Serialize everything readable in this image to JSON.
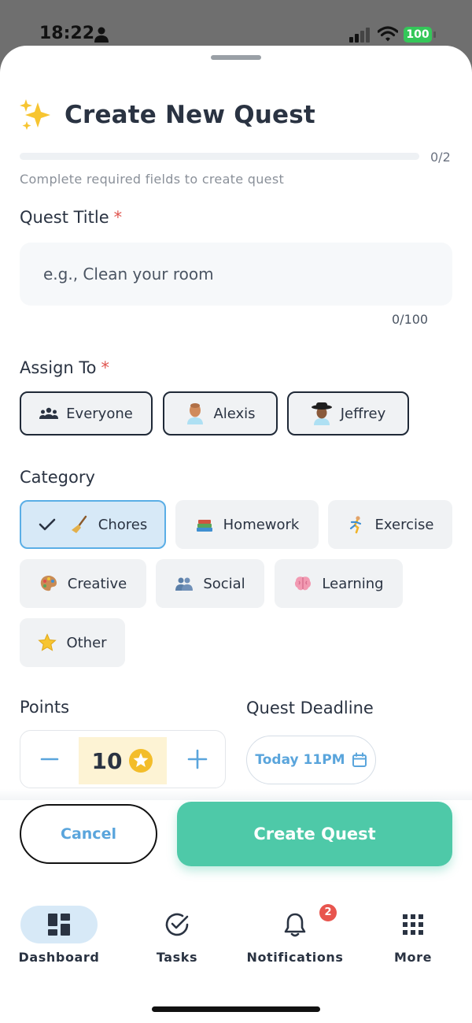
{
  "status": {
    "time": "18:22",
    "battery": "100"
  },
  "header": {
    "title": "Create New Quest"
  },
  "progress": {
    "count": "0/2",
    "fraction": 0,
    "hint": "Complete required fields to create quest"
  },
  "quest_title": {
    "label": "Quest Title",
    "required_mark": "*",
    "placeholder": "e.g., Clean your room",
    "value": "",
    "char_count": "0/100"
  },
  "assign": {
    "label": "Assign To",
    "required_mark": "*",
    "options": [
      {
        "label": "Everyone",
        "icon": "group-icon"
      },
      {
        "label": "Alexis",
        "icon": "avatar-alexis"
      },
      {
        "label": "Jeffrey",
        "icon": "avatar-jeffrey"
      }
    ]
  },
  "category": {
    "label": "Category",
    "selected": "Chores",
    "options": [
      {
        "label": "Chores",
        "icon": "broom-icon"
      },
      {
        "label": "Homework",
        "icon": "books-icon"
      },
      {
        "label": "Exercise",
        "icon": "runner-icon"
      },
      {
        "label": "Creative",
        "icon": "palette-icon"
      },
      {
        "label": "Social",
        "icon": "people-icon"
      },
      {
        "label": "Learning",
        "icon": "brain-icon"
      },
      {
        "label": "Other",
        "icon": "star-icon"
      }
    ]
  },
  "points": {
    "label": "Points",
    "value": "10",
    "decrement": "−",
    "increment": "+"
  },
  "deadline": {
    "label": "Quest Deadline",
    "value": "Today 11PM"
  },
  "actions": {
    "cancel": "Cancel",
    "create": "Create Quest"
  },
  "tabs": [
    {
      "label": "Dashboard",
      "icon": "dashboard-icon",
      "active": true
    },
    {
      "label": "Tasks",
      "icon": "check-circle-icon"
    },
    {
      "label": "Notifications",
      "icon": "bell-icon",
      "badge": "2"
    },
    {
      "label": "More",
      "icon": "grid-icon"
    }
  ],
  "colors": {
    "accent": "#4ec9a8",
    "link": "#5aa5dc",
    "selected_bg": "#d7e9f7",
    "required": "#e0554f"
  }
}
